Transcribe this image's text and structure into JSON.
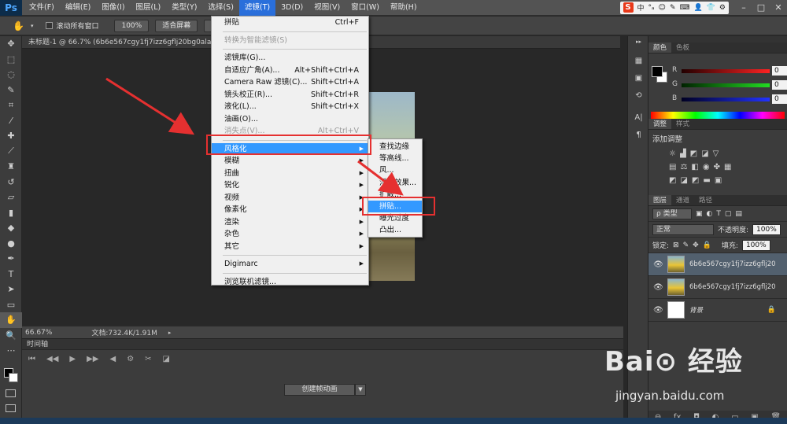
{
  "menubar": {
    "logo": "Ps",
    "items": [
      "文件(F)",
      "编辑(E)",
      "图像(I)",
      "图层(L)",
      "类型(Y)",
      "选择(S)",
      "滤镜(T)",
      "3D(D)",
      "视图(V)",
      "窗口(W)",
      "帮助(H)"
    ],
    "active_index": 6,
    "ime": {
      "logo": "S",
      "items": [
        "中",
        "°ₐ",
        "☺",
        "✎",
        "⌨",
        "👤",
        "👕",
        "⚙"
      ]
    },
    "window_buttons": [
      "–",
      "□",
      "✕"
    ]
  },
  "options": {
    "scroll_all_label": "滚动所有窗口",
    "zoom_100": "100%",
    "fit_screen": "适合屏幕",
    "fill_screen": "填"
  },
  "document": {
    "tab_title": "未标题-1 @ 66.7% (6b6e567cgy1fj7izz6gflj20bg0alab6 拷贝"
  },
  "status": {
    "zoom": "66.67%",
    "doc_size": "文档:732.4K/1.91M"
  },
  "timeline": {
    "tab_label": "时间轴",
    "create_animation": "创建帧动画"
  },
  "filter_menu": {
    "items": [
      {
        "label": "拼贴",
        "shortcut": "Ctrl+F"
      },
      {
        "sep": true
      },
      {
        "label": "转换为智能滤镜(S)",
        "disabled": true
      },
      {
        "sep": true
      },
      {
        "label": "滤镜库(G)..."
      },
      {
        "label": "自适应广角(A)...",
        "shortcut": "Alt+Shift+Ctrl+A"
      },
      {
        "label": "Camera Raw 滤镜(C)...",
        "shortcut": "Shift+Ctrl+A"
      },
      {
        "label": "镜头校正(R)...",
        "shortcut": "Shift+Ctrl+R"
      },
      {
        "label": "液化(L)...",
        "shortcut": "Shift+Ctrl+X"
      },
      {
        "label": "油画(O)..."
      },
      {
        "label": "消失点(V)...",
        "shortcut": "Alt+Ctrl+V",
        "disabled": true
      },
      {
        "sep": true
      },
      {
        "label": "风格化",
        "submenu": true,
        "highlighted": true
      },
      {
        "label": "模糊",
        "submenu": true
      },
      {
        "label": "扭曲",
        "submenu": true
      },
      {
        "label": "锐化",
        "submenu": true
      },
      {
        "label": "视频",
        "submenu": true
      },
      {
        "label": "像素化",
        "submenu": true
      },
      {
        "label": "渲染",
        "submenu": true
      },
      {
        "label": "杂色",
        "submenu": true
      },
      {
        "label": "其它",
        "submenu": true
      },
      {
        "sep": true
      },
      {
        "label": "Digimarc",
        "submenu": true
      },
      {
        "sep": true
      },
      {
        "label": "浏览联机滤镜..."
      }
    ]
  },
  "stylize_submenu": {
    "items": [
      {
        "label": "查找边缘"
      },
      {
        "label": "等高线..."
      },
      {
        "label": "风..."
      },
      {
        "label": "浮雕效果..."
      },
      {
        "label": "扩散..."
      },
      {
        "label": "拼贴...",
        "highlighted": true
      },
      {
        "label": "曝光过度"
      },
      {
        "label": "凸出..."
      }
    ]
  },
  "color_panel": {
    "tabs": [
      "颜色",
      "色板"
    ],
    "channels": [
      {
        "label": "R",
        "value": "0",
        "color": "#ff2020"
      },
      {
        "label": "G",
        "value": "0",
        "color": "#20d020"
      },
      {
        "label": "B",
        "value": "0",
        "color": "#2030ff"
      }
    ]
  },
  "adjust_panel": {
    "tabs": [
      "调整",
      "样式"
    ],
    "title": "添加调整"
  },
  "layers_panel": {
    "tabs": [
      "图层",
      "通道",
      "路径"
    ],
    "filter_kind": "ρ 类型",
    "blend_mode": "正常",
    "opacity_label": "不透明度:",
    "opacity": "100%",
    "lock_label": "锁定:",
    "fill_label": "填充:",
    "fill": "100%",
    "layers": [
      {
        "name": "6b6e567cgy1fj7izz6gflj20b...",
        "selected": true,
        "thumb": "img"
      },
      {
        "name": "6b6e567cgy1fj7izz6gflj20b...",
        "selected": false,
        "thumb": "img"
      },
      {
        "name": "背景",
        "selected": false,
        "thumb": "white",
        "italic": true,
        "locked": true
      }
    ]
  },
  "watermark": {
    "logo": "Bai⊙ 经验",
    "url": "jingyan.baidu.com"
  }
}
